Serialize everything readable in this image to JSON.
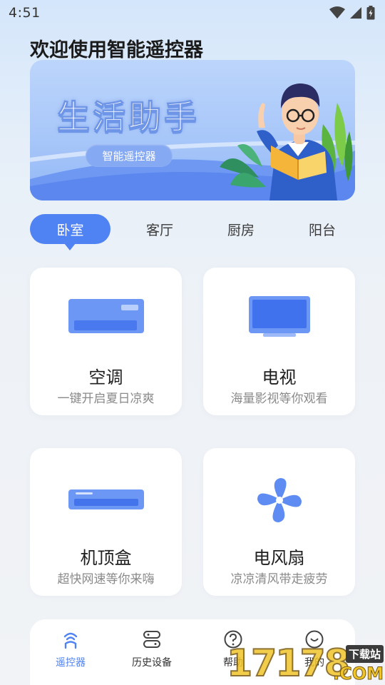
{
  "status_bar": {
    "time": "4:51"
  },
  "header": {
    "title": "欢迎使用智能遥控器"
  },
  "banner": {
    "heading": "生活助手",
    "pill": "智能遥控器"
  },
  "tabs": [
    {
      "label": "卧室",
      "active": true
    },
    {
      "label": "客厅",
      "active": false
    },
    {
      "label": "厨房",
      "active": false
    },
    {
      "label": "阳台",
      "active": false
    }
  ],
  "devices": [
    {
      "title": "空调",
      "subtitle": "一键开启夏日凉爽",
      "icon": "air-conditioner-icon"
    },
    {
      "title": "电视",
      "subtitle": "海量影视等你观看",
      "icon": "tv-icon"
    },
    {
      "title": "机顶盒",
      "subtitle": "超快网速等你来嗨",
      "icon": "set-top-box-icon"
    },
    {
      "title": "电风扇",
      "subtitle": "凉凉清风带走疲劳",
      "icon": "fan-icon"
    }
  ],
  "bottom_nav": [
    {
      "label": "遥控器",
      "icon": "remote-icon",
      "active": true
    },
    {
      "label": "历史设备",
      "icon": "history-icon",
      "active": false
    },
    {
      "label": "帮助",
      "icon": "help-icon",
      "active": false
    },
    {
      "label": "我的",
      "icon": "profile-icon",
      "active": false
    }
  ],
  "watermark": {
    "brand": "17178",
    "suffix": ".COM",
    "tag": "下载站"
  },
  "colors": {
    "accent": "#4f82f3",
    "banner": "#a8c7f9",
    "card": "#ffffff"
  }
}
